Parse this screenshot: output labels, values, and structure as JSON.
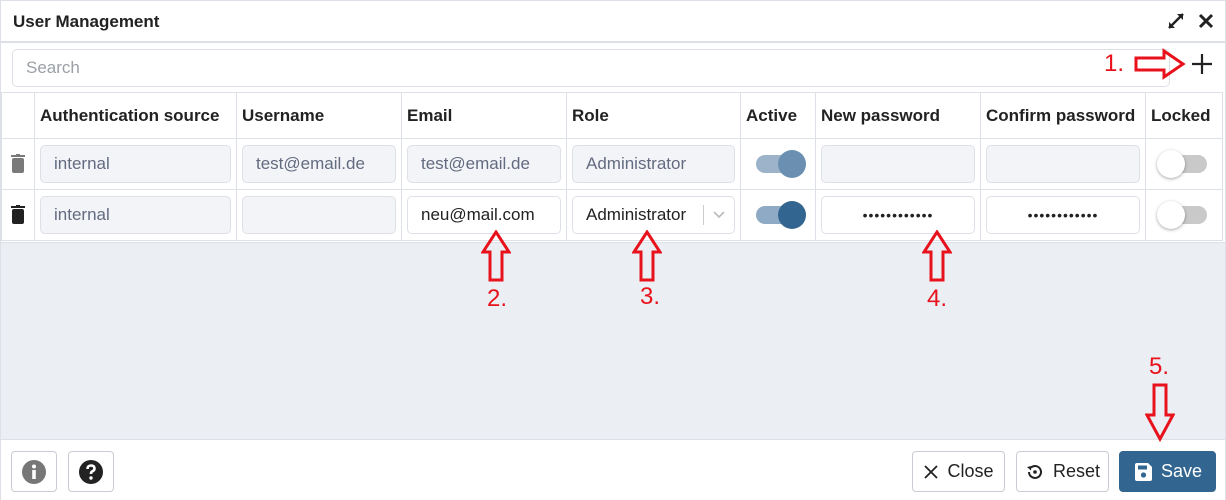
{
  "dialog": {
    "title": "User Management",
    "maximize_icon": "expand-arrows-icon",
    "close_icon": "close-x-icon"
  },
  "search": {
    "placeholder": "Search",
    "value": ""
  },
  "add_button": {
    "icon": "plus-icon"
  },
  "table": {
    "columns": [
      "",
      "Authentication source",
      "Username",
      "Email",
      "Role",
      "Active",
      "New password",
      "Confirm password",
      "Locked"
    ],
    "rows": [
      {
        "auth_source": "internal",
        "username": "test@email.de",
        "email": "test@email.de",
        "role": "Administrator",
        "active": true,
        "new_password": "",
        "confirm_password": "",
        "locked": false,
        "editable": false
      },
      {
        "auth_source": "internal",
        "username": "",
        "email": "neu@mail.com",
        "role": "Administrator",
        "active": true,
        "new_password": "••••••••••••",
        "confirm_password": "••••••••••••",
        "locked": false,
        "editable": true
      }
    ]
  },
  "footer": {
    "info_icon": "info-circle-icon",
    "help_icon": "question-circle-icon",
    "close_label": "Close",
    "reset_label": "Reset",
    "save_label": "Save"
  },
  "annotations": {
    "step1": "1.",
    "step2": "2.",
    "step3": "3.",
    "step4": "4.",
    "step5": "5."
  },
  "colors": {
    "primary": "#326690",
    "annotation": "#e8121c",
    "toggle_on_knob_row1": "#6a8fb0",
    "toggle_on_knob_row2": "#326690",
    "empty_area": "#ebeef3"
  }
}
